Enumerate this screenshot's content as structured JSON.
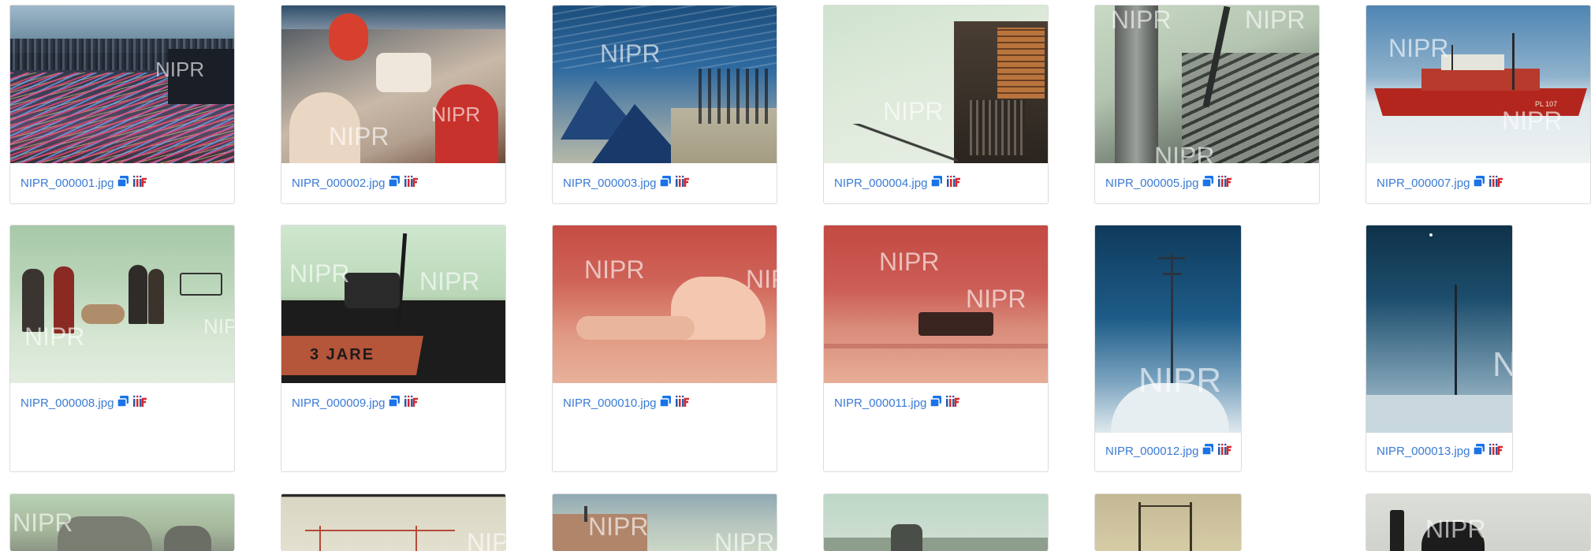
{
  "grid": {
    "watermark": "NIPR",
    "rows": [
      [
        {
          "file": "NIPR_000001.jpg"
        },
        {
          "file": "NIPR_000002.jpg"
        },
        {
          "file": "NIPR_000003.jpg"
        },
        {
          "file": "NIPR_000004.jpg"
        },
        {
          "file": "NIPR_000005.jpg"
        },
        {
          "file": "NIPR_000007.jpg"
        }
      ],
      [
        {
          "file": "NIPR_000008.jpg"
        },
        {
          "file": "NIPR_000009.jpg",
          "sign": "3 JARE"
        },
        {
          "file": "NIPR_000010.jpg"
        },
        {
          "file": "NIPR_000011.jpg"
        },
        {
          "file": "NIPR_000012.jpg"
        },
        {
          "file": "NIPR_000013.jpg"
        }
      ],
      [
        {
          "file": ""
        },
        {
          "file": ""
        },
        {
          "file": ""
        },
        {
          "file": ""
        },
        {
          "file": ""
        },
        {
          "file": ""
        }
      ]
    ],
    "ship_label": "PL 107",
    "icons": {
      "copy": "copy-icon",
      "iiif": "iiif-icon"
    },
    "colors": {
      "link": "#3a7bd5",
      "copy_icon": "#1a73e8",
      "iiif_red": "#d9262b",
      "iiif_blue": "#2a5aa6"
    }
  }
}
